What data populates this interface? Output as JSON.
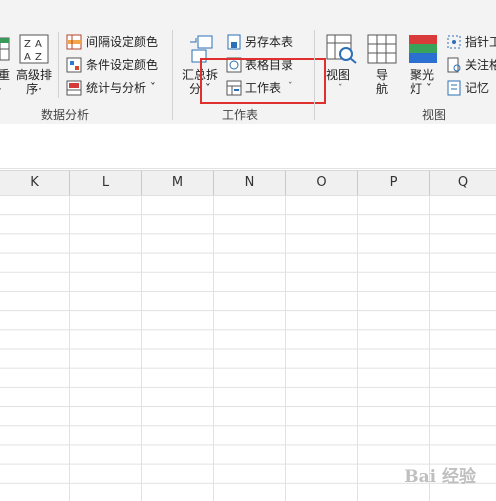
{
  "ribbon": {
    "data_analysis": {
      "partial_btn_label": "重\n·",
      "advanced_sort_label": "高级排\n序·",
      "interval_color_label": "间隔设定颜色",
      "condition_color_label": "条件设定颜色",
      "stats_label": "统计与分析 ˇ",
      "group_label": "数据分析"
    },
    "worksheet": {
      "summary_split_label": "汇总拆\n分 ˇ",
      "save_as_label": "另存本表",
      "table_toc_label": "表格目录",
      "worksheet_label": "工作表",
      "worksheet_chevron": "ˇ",
      "group_label": "工作表"
    },
    "view": {
      "view_label": "视图",
      "view_chevron": "ˇ",
      "nav_label": "导\n航",
      "spotlight_label": "聚光\n灯 ˇ",
      "pointer_label": "指针工",
      "focus_label": "关注格",
      "memory_label": "记忆",
      "group_label": "视图"
    }
  },
  "columns": [
    "K",
    "L",
    "M",
    "N",
    "O",
    "P",
    "Q"
  ],
  "watermark": "Bai 经验"
}
